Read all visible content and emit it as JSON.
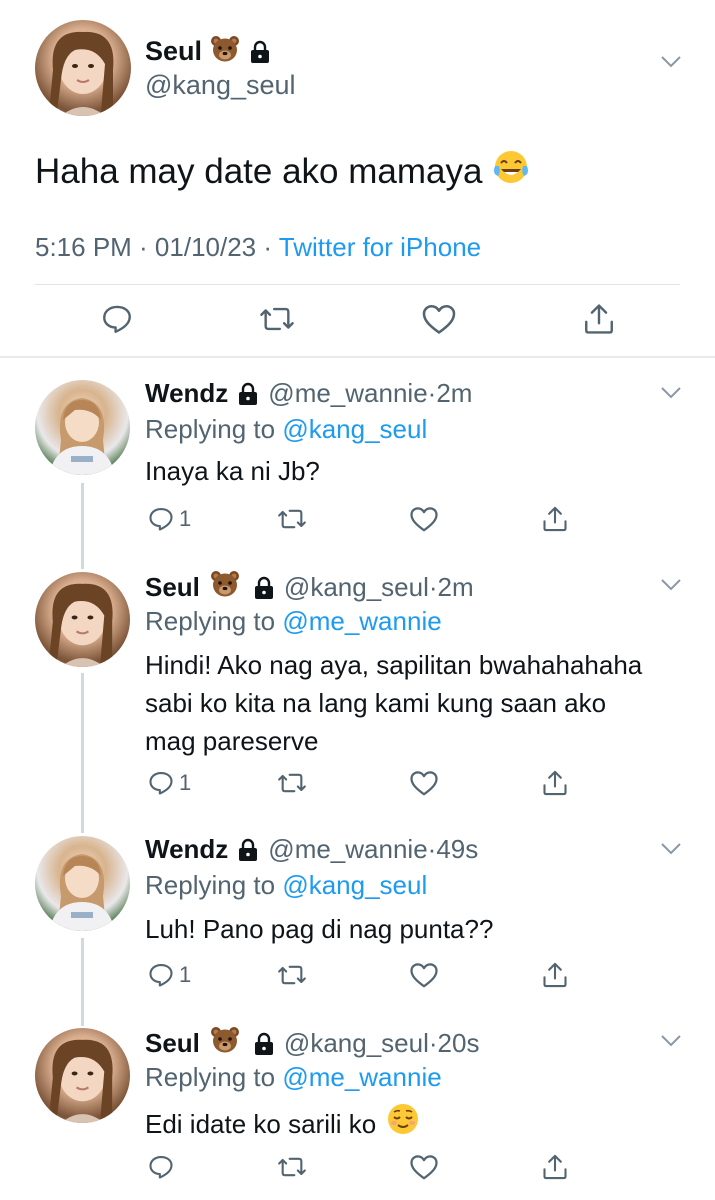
{
  "main_tweet": {
    "name": "Seul",
    "handle": "@kang_seul",
    "text": "Haha may date ako mamaya",
    "time": "5:16 PM · 01/10/23 ·",
    "source": "Twitter for iPhone",
    "icons": [
      "bear-face-emoji",
      "lock-icon",
      "chevron-down-icon",
      "tears-of-joy-emoji",
      "reply-icon",
      "retweet-icon",
      "like-icon",
      "share-icon"
    ]
  },
  "replies": [
    {
      "name": "Wendz",
      "handle": "@me_wannie",
      "time": "2m",
      "replying_label": "Replying to",
      "replying_to": "@kang_seul",
      "text": "Inaya ka ni Jb?",
      "reply_count": "1"
    },
    {
      "name": "Seul",
      "handle": "@kang_seul",
      "time": "2m",
      "replying_label": "Replying to",
      "replying_to": "@me_wannie",
      "text_lines": [
        "Hindi! Ako nag aya, sapilitan bwahahahaha",
        "sabi ko kita na lang kami kung saan ako",
        "mag pareserve"
      ],
      "reply_count": "1"
    },
    {
      "name": "Wendz",
      "handle": "@me_wannie",
      "time": "49s",
      "replying_label": "Replying to",
      "replying_to": "@kang_seul",
      "text": "Luh! Pano pag di nag punta??",
      "reply_count": "1"
    },
    {
      "name": "Seul",
      "handle": "@kang_seul",
      "time": "20s",
      "replying_label": "Replying to",
      "replying_to": "@me_wannie",
      "text": "Edi idate ko sarili ko",
      "reply_count": ""
    }
  ],
  "colors": {
    "accent": "#1d9bf0",
    "secondary_text": "#536471",
    "primary_text": "#0f1419",
    "divider": "#e1e5e8"
  }
}
